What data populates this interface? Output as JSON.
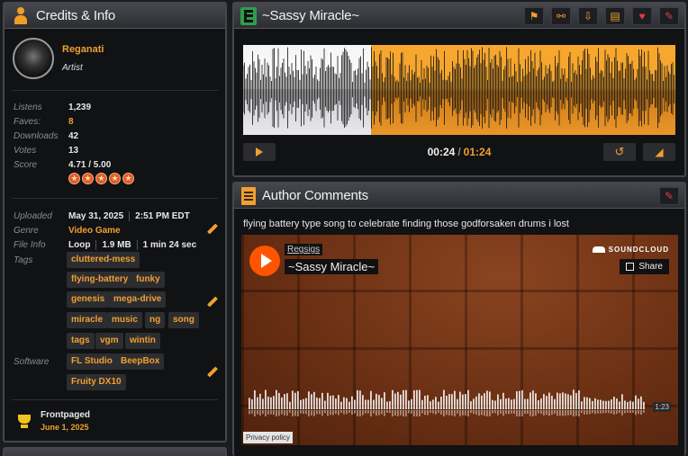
{
  "credits": {
    "title": "Credits & Info",
    "artist": {
      "name": "Reganati",
      "role": "Artist"
    },
    "stats": [
      {
        "label": "Listens",
        "value": "1,239",
        "highlight": false
      },
      {
        "label": "Faves:",
        "value": "8",
        "highlight": true
      },
      {
        "label": "Downloads",
        "value": "42",
        "highlight": false
      },
      {
        "label": "Votes",
        "value": "13",
        "highlight": false
      },
      {
        "label": "Score",
        "value": "4.71 / 5.00",
        "highlight": false
      }
    ],
    "rating_stars": 5,
    "info": {
      "uploaded_label": "Uploaded",
      "uploaded_date": "May 31, 2025",
      "uploaded_time": "2:51 PM EDT",
      "genre_label": "Genre",
      "genre_value": "Video Game",
      "fileinfo_label": "File Info",
      "file_type": "Loop",
      "file_size": "1.9 MB",
      "file_length": "1 min 24 sec",
      "tags_label": "Tags",
      "tags": [
        "cluttered-mess",
        "flying-battery",
        "funky",
        "genesis",
        "mega-drive",
        "miracle",
        "music",
        "ng",
        "song",
        "tags",
        "vgm",
        "wintin"
      ],
      "software_label": "Software",
      "software": [
        "FL Studio",
        "BeepBox",
        "Fruity DX10"
      ]
    },
    "frontpaged": {
      "title": "Frontpaged",
      "date": "June 1, 2025"
    }
  },
  "player": {
    "title": "~Sassy Miracle~",
    "tools": [
      "flag-icon",
      "share-icon",
      "download-icon",
      "playlist-icon",
      "favorite-icon",
      "edit-icon"
    ],
    "played_fraction": 0.296,
    "current_time": "00:24",
    "duration": "01:24"
  },
  "comments": {
    "title": "Author Comments",
    "text": "flying battery type song to celebrate finding those godforsaken drums i lost",
    "embed": {
      "user": "Regsigs",
      "track": "~Sassy Miracle~",
      "brand": "SOUNDCLOUD",
      "share_label": "Share",
      "duration": "1:23",
      "privacy": "Privacy policy"
    }
  },
  "colors": {
    "accent": "#f0a030",
    "panel_bg": "#111214",
    "soundcloud": "#ff5500"
  }
}
